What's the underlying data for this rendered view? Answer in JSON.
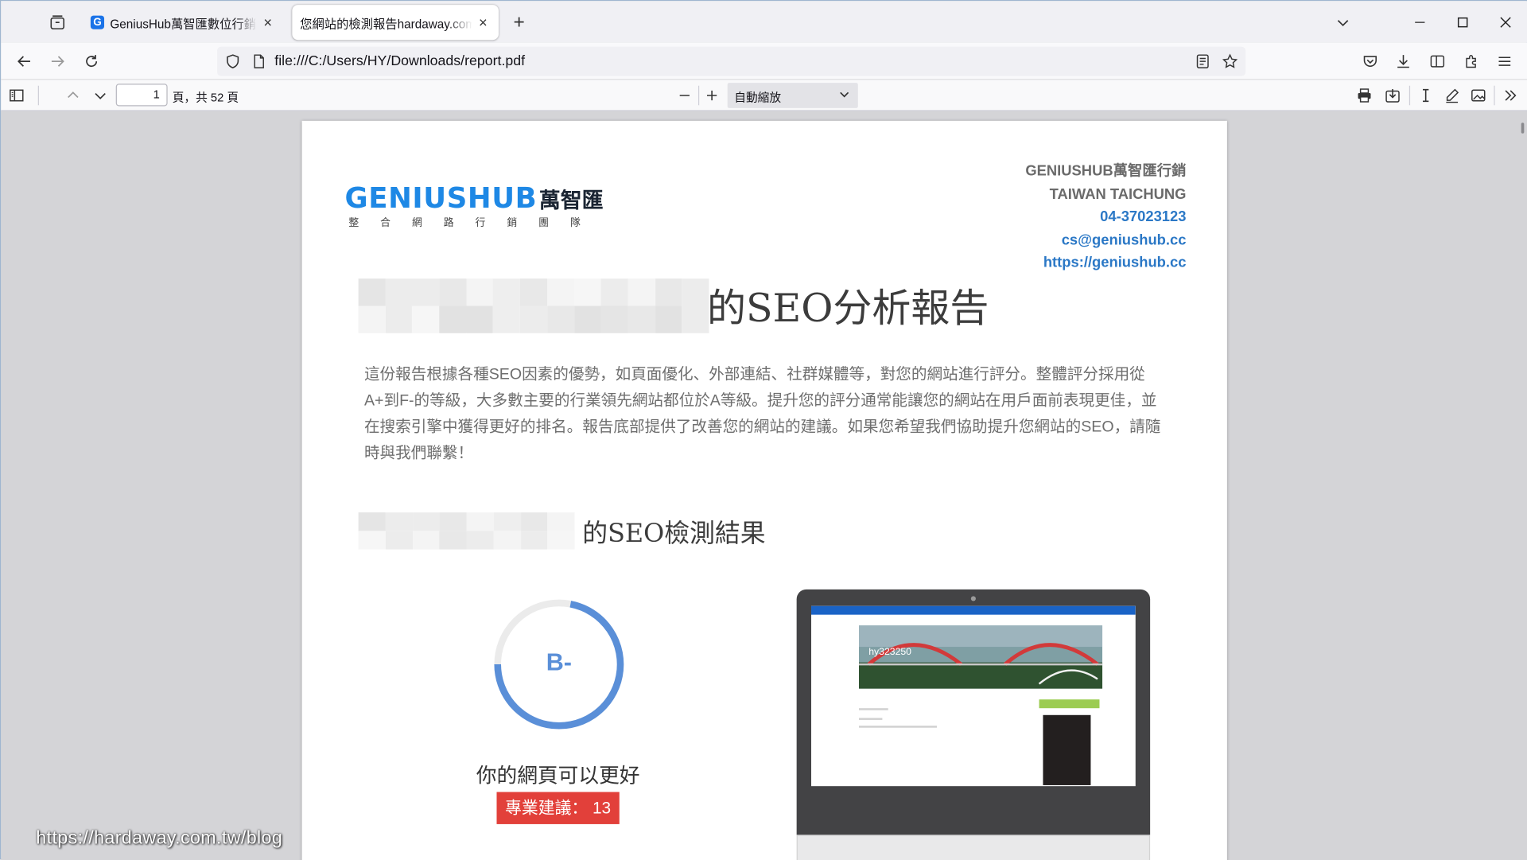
{
  "browser": {
    "tabs": [
      {
        "title": "GeniusHub萬智匯數位行銷 - 全方位網路行銷",
        "favicon": "G",
        "active": false
      },
      {
        "title": "您網站的檢測報告hardaway.com.tw",
        "active": true
      }
    ],
    "url": "file:///C:/Users/HY/Downloads/report.pdf"
  },
  "pdf_toolbar": {
    "page_number": "1",
    "page_total": "頁，共 52 頁",
    "zoom": "自動縮放"
  },
  "report": {
    "logo_text": "GENIUSHUB",
    "logo_cn": "萬智匯",
    "logo_tagline": "整合網路行銷團隊",
    "contact": {
      "company": "GENIUSHUB萬智匯行銷",
      "location": "TAIWAN TAICHUNG",
      "phone": "04-37023123",
      "email": "cs@geniushub.cc",
      "website": "https://geniushub.cc"
    },
    "title_suffix": "的SEO分析報告",
    "intro": "這份報告根據各種SEO因素的優勢，如頁面優化、外部連結、社群媒體等，對您的網站進行評分。整體評分採用從A+到F-的等級，大多數主要的行業領先網站都位於A等級。提升您的評分通常能讓您的網站在用戶面前表現更佳，並在搜索引擎中獲得更好的排名。報告底部提供了改善您的網站的建議。如果您希望我們協助提升您網站的SEO，請隨時與我們聯繫！",
    "results_title_suffix": "的SEO檢測結果",
    "grade": "B-",
    "score_fraction": 0.72,
    "caption": "你的網頁可以更好",
    "advice_badge": "專業建議： 13",
    "screenshot_text": "hy323250"
  },
  "watermark": "https://hardaway.com.tw/blog",
  "colors": {
    "accent_blue": "#2b78c6",
    "gauge_blue": "#5a8fd8",
    "badge_red": "#e2403a"
  }
}
